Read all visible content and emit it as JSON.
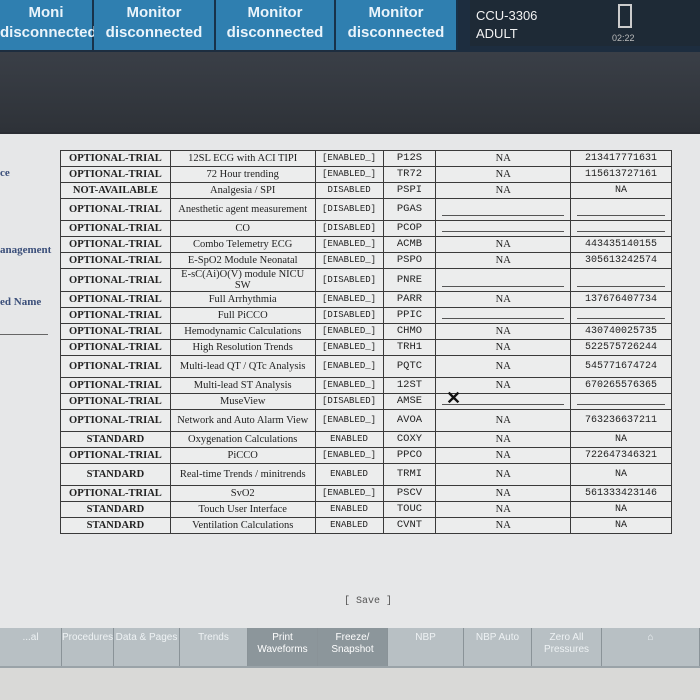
{
  "top_tabs": [
    {
      "line1": "Moni",
      "line2": "disconnected"
    },
    {
      "line1": "Monitor",
      "line2": "disconnected"
    },
    {
      "line1": "Monitor",
      "line2": "disconnected"
    },
    {
      "line1": "Monitor",
      "line2": "disconnected"
    }
  ],
  "patient": {
    "bed": "CCU-3306",
    "type": "ADULT",
    "clock": "02:22"
  },
  "left_labels": [
    "ce",
    "anagement",
    "ed Name"
  ],
  "options": [
    {
      "status": "OPTIONAL-TRIAL",
      "name": "12SL ECG with ACI TIPI",
      "state": "[ENABLED_]",
      "code": "P12S",
      "na": "NA",
      "serial": "213417771631"
    },
    {
      "status": "OPTIONAL-TRIAL",
      "name": "72 Hour trending",
      "state": "[ENABLED_]",
      "code": "TR72",
      "na": "NA",
      "serial": "115613727161"
    },
    {
      "status": "NOT-AVAILABLE",
      "name": "Analgesia / SPI",
      "state": "DISABLED",
      "code": "PSPI",
      "na": "NA",
      "serial": "NA"
    },
    {
      "status": "OPTIONAL-TRIAL",
      "name": "Anesthetic agent measurement",
      "state": "[DISABLED]",
      "code": "PGAS",
      "na": "",
      "serial": ""
    },
    {
      "status": "OPTIONAL-TRIAL",
      "name": "CO",
      "state": "[DISABLED]",
      "code": "PCOP",
      "na": "",
      "serial": ""
    },
    {
      "status": "OPTIONAL-TRIAL",
      "name": "Combo Telemetry ECG",
      "state": "[ENABLED_]",
      "code": "ACMB",
      "na": "NA",
      "serial": "443435140155"
    },
    {
      "status": "OPTIONAL-TRIAL",
      "name": "E-SpO2 Module Neonatal",
      "state": "[ENABLED_]",
      "code": "PSPO",
      "na": "NA",
      "serial": "305613242574"
    },
    {
      "status": "OPTIONAL-TRIAL",
      "name": "E-sC(Ai)O(V) module NICU SW",
      "state": "[DISABLED]",
      "code": "PNRE",
      "na": "",
      "serial": ""
    },
    {
      "status": "OPTIONAL-TRIAL",
      "name": "Full Arrhythmia",
      "state": "[ENABLED_]",
      "code": "PARR",
      "na": "NA",
      "serial": "137676407734"
    },
    {
      "status": "OPTIONAL-TRIAL",
      "name": "Full PiCCO",
      "state": "[DISABLED]",
      "code": "PPIC",
      "na": "",
      "serial": ""
    },
    {
      "status": "OPTIONAL-TRIAL",
      "name": "Hemodynamic Calculations",
      "state": "[ENABLED_]",
      "code": "CHMO",
      "na": "NA",
      "serial": "430740025735"
    },
    {
      "status": "OPTIONAL-TRIAL",
      "name": "High Resolution Trends",
      "state": "[ENABLED_]",
      "code": "TRH1",
      "na": "NA",
      "serial": "522575726244"
    },
    {
      "status": "OPTIONAL-TRIAL",
      "name": "Multi-lead QT / QTc Analysis",
      "state": "[ENABLED_]",
      "code": "PQTC",
      "na": "NA",
      "serial": "545771674724"
    },
    {
      "status": "OPTIONAL-TRIAL",
      "name": "Multi-lead ST Analysis",
      "state": "[ENABLED_]",
      "code": "12ST",
      "na": "NA",
      "serial": "670265576365"
    },
    {
      "status": "OPTIONAL-TRIAL",
      "name": "MuseView",
      "state": "[DISABLED]",
      "code": "AMSE",
      "na": "",
      "serial": ""
    },
    {
      "status": "OPTIONAL-TRIAL",
      "name": "Network and Auto Alarm View",
      "state": "[ENABLED_]",
      "code": "AVOA",
      "na": "NA",
      "serial": "763236637211"
    },
    {
      "status": "STANDARD",
      "name": "Oxygenation Calculations",
      "state": "ENABLED",
      "code": "COXY",
      "na": "NA",
      "serial": "NA"
    },
    {
      "status": "OPTIONAL-TRIAL",
      "name": "PiCCO",
      "state": "[ENABLED_]",
      "code": "PPCO",
      "na": "NA",
      "serial": "722647346321"
    },
    {
      "status": "STANDARD",
      "name": "Real-time Trends / minitrends",
      "state": "ENABLED",
      "code": "TRMI",
      "na": "NA",
      "serial": "NA"
    },
    {
      "status": "OPTIONAL-TRIAL",
      "name": "SvO2",
      "state": "[ENABLED_]",
      "code": "PSCV",
      "na": "NA",
      "serial": "561333423146"
    },
    {
      "status": "STANDARD",
      "name": "Touch User Interface",
      "state": "ENABLED",
      "code": "TOUC",
      "na": "NA",
      "serial": "NA"
    },
    {
      "status": "STANDARD",
      "name": "Ventilation Calculations",
      "state": "ENABLED",
      "code": "CVNT",
      "na": "NA",
      "serial": "NA"
    }
  ],
  "save_label": "[ Save ]",
  "softkeys": [
    {
      "label": "...al"
    },
    {
      "label": "Procedures"
    },
    {
      "label": "Data & Pages"
    },
    {
      "label": "Trends"
    },
    {
      "label": "Print Waveforms"
    },
    {
      "label": "Freeze/ Snapshot"
    },
    {
      "label": "NBP"
    },
    {
      "label": "NBP Auto"
    },
    {
      "label": "Zero All Pressures"
    },
    {
      "label": ""
    }
  ]
}
